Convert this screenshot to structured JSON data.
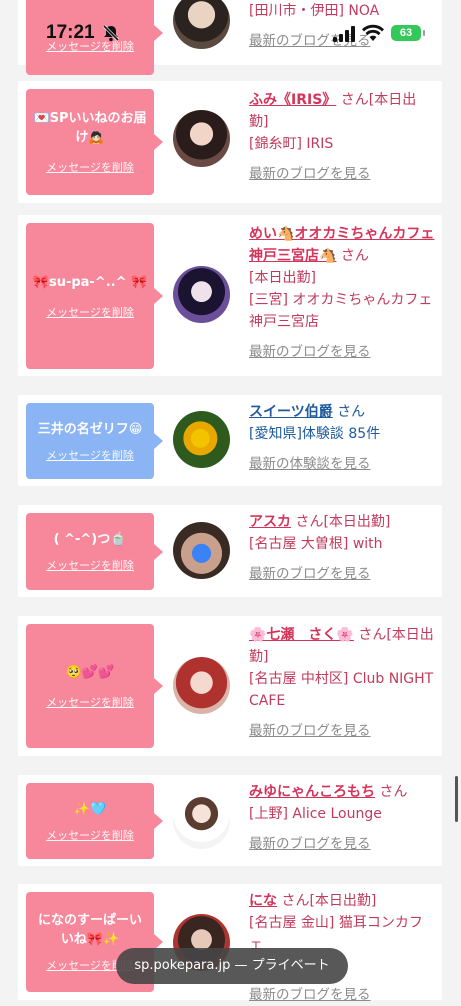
{
  "status_bar": {
    "time": "17:21",
    "battery": "63"
  },
  "cards": [
    {
      "message": "",
      "delete_label": "メッセージを削除",
      "name": "",
      "suffix": "",
      "shop": "[田川市・伊田] NOA",
      "link": "最新のブログを見る"
    },
    {
      "message": "💌SPいいねのお届け🙇🏻",
      "delete_label": "メッセージを削除",
      "name": "ふみ《IRIS》",
      "suffix": "さん[本日出勤]",
      "shop": "[錦糸町] IRIS",
      "link": "最新のブログを見る"
    },
    {
      "message": "🎀su-pa-^..^ 🎀",
      "delete_label": "メッセージを削除",
      "name": "めい🐴オオカミちゃんカフェ神戸三宮店🐴",
      "suffix": "さん",
      "status": "[本日出勤]",
      "shop": "[三宮] オオカミちゃんカフェ神戸三宮店",
      "link": "最新のブログを見る"
    },
    {
      "message": "三井の名ゼリフ😁",
      "delete_label": "メッセージを削除",
      "name": "スイーツ伯爵",
      "suffix": "さん",
      "shop": "[愛知県]体験談 85件",
      "link": "最新の体験談を見る"
    },
    {
      "message": "( ^-^)つ🍵",
      "delete_label": "メッセージを削除",
      "name": "アスカ",
      "suffix": "さん[本日出勤]",
      "shop": "[名古屋 大曽根] with",
      "link": "最新のブログを見る"
    },
    {
      "message": "🥺💕💕",
      "delete_label": "メッセージを削除",
      "name": "🌸七瀬　さく🌸",
      "suffix": "さん[本日出勤]",
      "shop": "[名古屋 中村区] Club NIGHT CAFE",
      "link": "最新のブログを見る"
    },
    {
      "message": "✨🩵",
      "delete_label": "メッセージを削除",
      "name": "みゆにゃんころもち",
      "suffix": "さん",
      "shop": "[上野] Alice Lounge",
      "link": "最新のブログを見る"
    },
    {
      "message": "になのすーぱーいいね🎀✨",
      "delete_label": "メッセージを削除",
      "name": "にな",
      "suffix": "さん[本日出勤]",
      "shop": "[名古屋 金山] 猫耳コンカフェ",
      "link": "最新のブログを見る"
    }
  ],
  "browser": {
    "url": "sp.pokepara.jp — プライベート"
  },
  "colors": {
    "bubble_pink": "#f7879b",
    "bubble_blue": "#8ab4f4",
    "name_pink": "#d5345a",
    "name_blue": "#1e5a9c"
  }
}
